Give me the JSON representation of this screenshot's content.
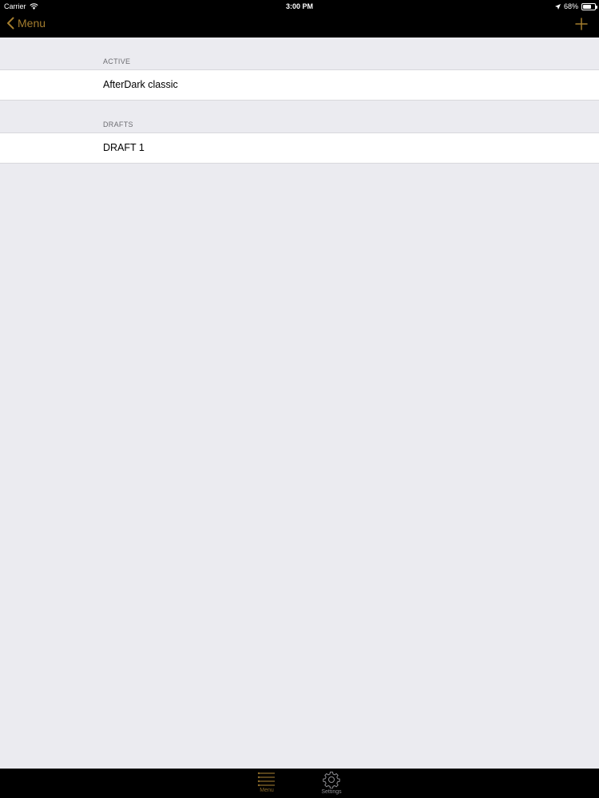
{
  "status_bar": {
    "carrier": "Carrier",
    "time": "3:00 PM",
    "battery_percent": "68%",
    "battery_level": 0.68
  },
  "nav": {
    "back_label": "Menu",
    "accent_color": "#a47d2e"
  },
  "sections": [
    {
      "header": "ACTIVE",
      "rows": [
        "AfterDark classic"
      ]
    },
    {
      "header": "DRAFTS",
      "rows": [
        "DRAFT 1"
      ]
    }
  ],
  "tab_bar": {
    "tabs": [
      {
        "label": "Menu",
        "icon": "list-icon",
        "selected": true
      },
      {
        "label": "Settings",
        "icon": "gear-icon",
        "selected": false
      }
    ]
  }
}
